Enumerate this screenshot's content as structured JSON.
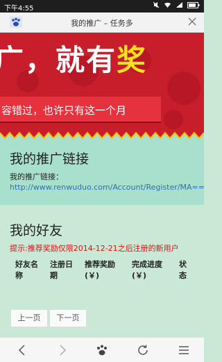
{
  "status_bar": {
    "time": "下午4:55"
  },
  "browser": {
    "page_title": "我的推广 – 任务多"
  },
  "banner": {
    "headline_a": "广，就有",
    "headline_b": "奖",
    "subline": "容错过，也许只有这一个月"
  },
  "promo": {
    "heading": "我的推广链接",
    "link_label": "我的推广链接：",
    "link_url": "http://www.renwuduo.com/Account/Register/MA=="
  },
  "friends": {
    "heading": "我的好友",
    "notice": "提示:推荐奖励仅限2014-12-21之后注册的新用户",
    "columns": [
      {
        "line1": "好友名",
        "line2": "称"
      },
      {
        "line1": "注册日",
        "line2": "期"
      },
      {
        "line1": "推荐奖励",
        "line2": "(￥)"
      },
      {
        "line1": "完成进度",
        "line2": "(￥)"
      },
      {
        "line1": "状",
        "line2": "态"
      }
    ]
  },
  "pager": {
    "prev": "上一页",
    "next": "下一页"
  },
  "icons": {
    "back": "chevron-left-icon",
    "forward": "chevron-right-icon",
    "home": "baidu-paw-icon",
    "refresh": "refresh-icon",
    "menu": "menu-icon"
  },
  "colors": {
    "banner_red": "#c81d2a",
    "highlight_yellow": "#ffe21a",
    "section_green": "#a9e0cd",
    "page_green": "#c9e8d6",
    "link_blue": "#2f6fb3",
    "notice_red": "#dd1111"
  }
}
